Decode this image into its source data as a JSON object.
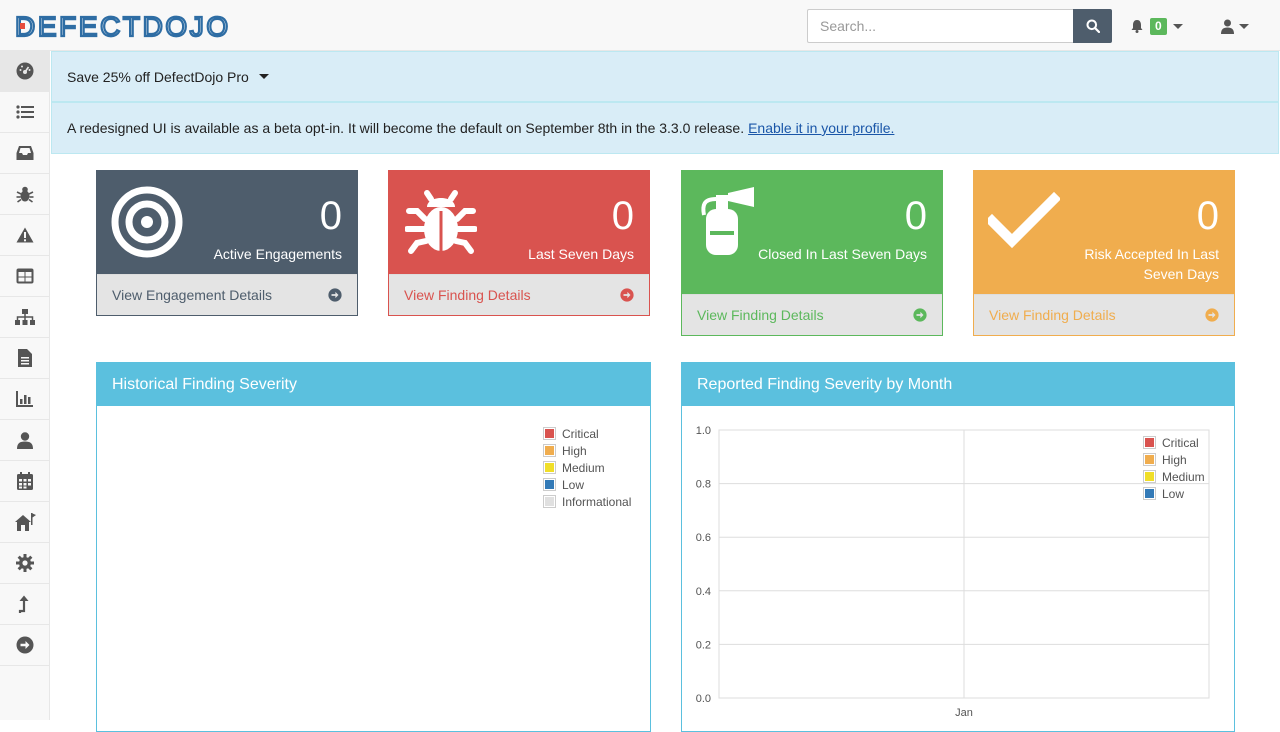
{
  "navbar": {
    "logo_text": "DEFECTDOJO",
    "search_placeholder": "Search...",
    "notification_count": "0"
  },
  "sidebar": {
    "items": [
      {
        "name": "dashboard",
        "icon": "tachometer-icon"
      },
      {
        "name": "products",
        "icon": "list-icon"
      },
      {
        "name": "engagements",
        "icon": "inbox-icon"
      },
      {
        "name": "findings",
        "icon": "bug-icon"
      },
      {
        "name": "risk-acceptances",
        "icon": "warning-icon"
      },
      {
        "name": "components",
        "icon": "table-icon"
      },
      {
        "name": "endpoints",
        "icon": "sitemap-icon"
      },
      {
        "name": "reports",
        "icon": "file-icon"
      },
      {
        "name": "metrics",
        "icon": "bar-chart-icon"
      },
      {
        "name": "users",
        "icon": "user-icon"
      },
      {
        "name": "calendar",
        "icon": "calendar-icon"
      },
      {
        "name": "questionnaires",
        "icon": "house-flag-icon"
      },
      {
        "name": "configuration",
        "icon": "gear-icon"
      },
      {
        "name": "api",
        "icon": "arrow-up-turn-icon"
      },
      {
        "name": "collapse",
        "icon": "arrow-circle-right-icon"
      }
    ]
  },
  "alerts": {
    "promo": "Save 25% off DefectDojo Pro",
    "beta_text": "A redesigned UI is available as a beta opt-in. It will become the default on September 8th in the 3.3.0 release.",
    "beta_link": "Enable it in your profile."
  },
  "panels": [
    {
      "count": "0",
      "label": "Active Engagements",
      "link": "View Engagement Details",
      "color": "#4e5d6c",
      "icon": "bullseye-icon"
    },
    {
      "count": "0",
      "label": "Last Seven Days",
      "link": "View Finding Details",
      "color": "#d9534f",
      "icon": "bug-icon"
    },
    {
      "count": "0",
      "label": "Closed In Last Seven Days",
      "link": "View Finding Details",
      "color": "#5cb85c",
      "icon": "fire-extinguisher-icon"
    },
    {
      "count": "0",
      "label": "Risk Accepted In Last Seven Days",
      "link": "View Finding Details",
      "color": "#f0ad4e",
      "icon": "check-icon"
    }
  ],
  "charts": {
    "historical_title": "Historical Finding Severity",
    "monthly_title": "Reported Finding Severity by Month"
  },
  "chart_data": [
    {
      "type": "pie",
      "title": "Historical Finding Severity",
      "legend": [
        "Critical",
        "High",
        "Medium",
        "Low",
        "Informational"
      ],
      "legend_colors": [
        "#d9534f",
        "#f0ad4e",
        "#f0de28",
        "#337ab7",
        "#e0e0e0"
      ],
      "legend_position": "top-right",
      "values": []
    },
    {
      "type": "line",
      "title": "Reported Finding Severity by Month",
      "categories": [
        "Jan"
      ],
      "ylim": [
        0,
        1.0
      ],
      "y_ticks": [
        "1.0",
        "0.8",
        "0.6",
        "0.4",
        "0.2",
        "0.0"
      ],
      "grid": true,
      "legend_position": "top-right",
      "series": [
        {
          "name": "Critical",
          "color": "#d9534f",
          "values": []
        },
        {
          "name": "High",
          "color": "#f0ad4e",
          "values": []
        },
        {
          "name": "Medium",
          "color": "#f0de28",
          "values": []
        },
        {
          "name": "Low",
          "color": "#337ab7",
          "values": []
        }
      ]
    }
  ]
}
